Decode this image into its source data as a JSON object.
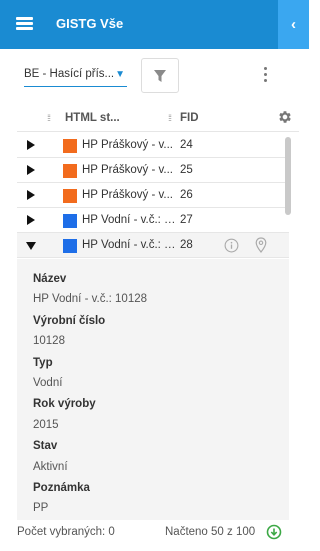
{
  "header": {
    "title": "GISTG Vše",
    "menu_icon": "hamburger-icon",
    "collapse_icon": "chevron-left-icon",
    "accent": "#1a8bd2"
  },
  "toolbar": {
    "layer_select": "BE - Hasící přís...",
    "filter_icon": "filter-icon",
    "more_icon": "more-vert-icon"
  },
  "table": {
    "columns": [
      "HTML st...",
      "FID"
    ],
    "rows": [
      {
        "name": "HP Práškový - v...",
        "fid": "24",
        "color": "#f26b1d",
        "expanded": false
      },
      {
        "name": "HP Práškový - v...",
        "fid": "25",
        "color": "#f26b1d",
        "expanded": false
      },
      {
        "name": "HP Práškový - v...",
        "fid": "26",
        "color": "#f26b1d",
        "expanded": false
      },
      {
        "name": "HP Vodní - v.č.: 1...",
        "fid": "27",
        "color": "#1e6ee8",
        "expanded": false
      },
      {
        "name": "HP Vodní - v.č.: 1...",
        "fid": "28",
        "color": "#1e6ee8",
        "expanded": true
      }
    ]
  },
  "detail": {
    "fields": [
      {
        "label": "Název",
        "value": "HP Vodní - v.č.: 10128"
      },
      {
        "label": "Výrobní číslo",
        "value": "10128"
      },
      {
        "label": "Typ",
        "value": "Vodní"
      },
      {
        "label": "Rok výroby",
        "value": "2015"
      },
      {
        "label": "Stav",
        "value": "Aktivní"
      },
      {
        "label": "Poznámka",
        "value": "PP"
      }
    ]
  },
  "footer": {
    "selected": "Počet vybraných: 0",
    "loaded": "Načteno 50 z 100",
    "load_icon": "load-more-icon"
  }
}
